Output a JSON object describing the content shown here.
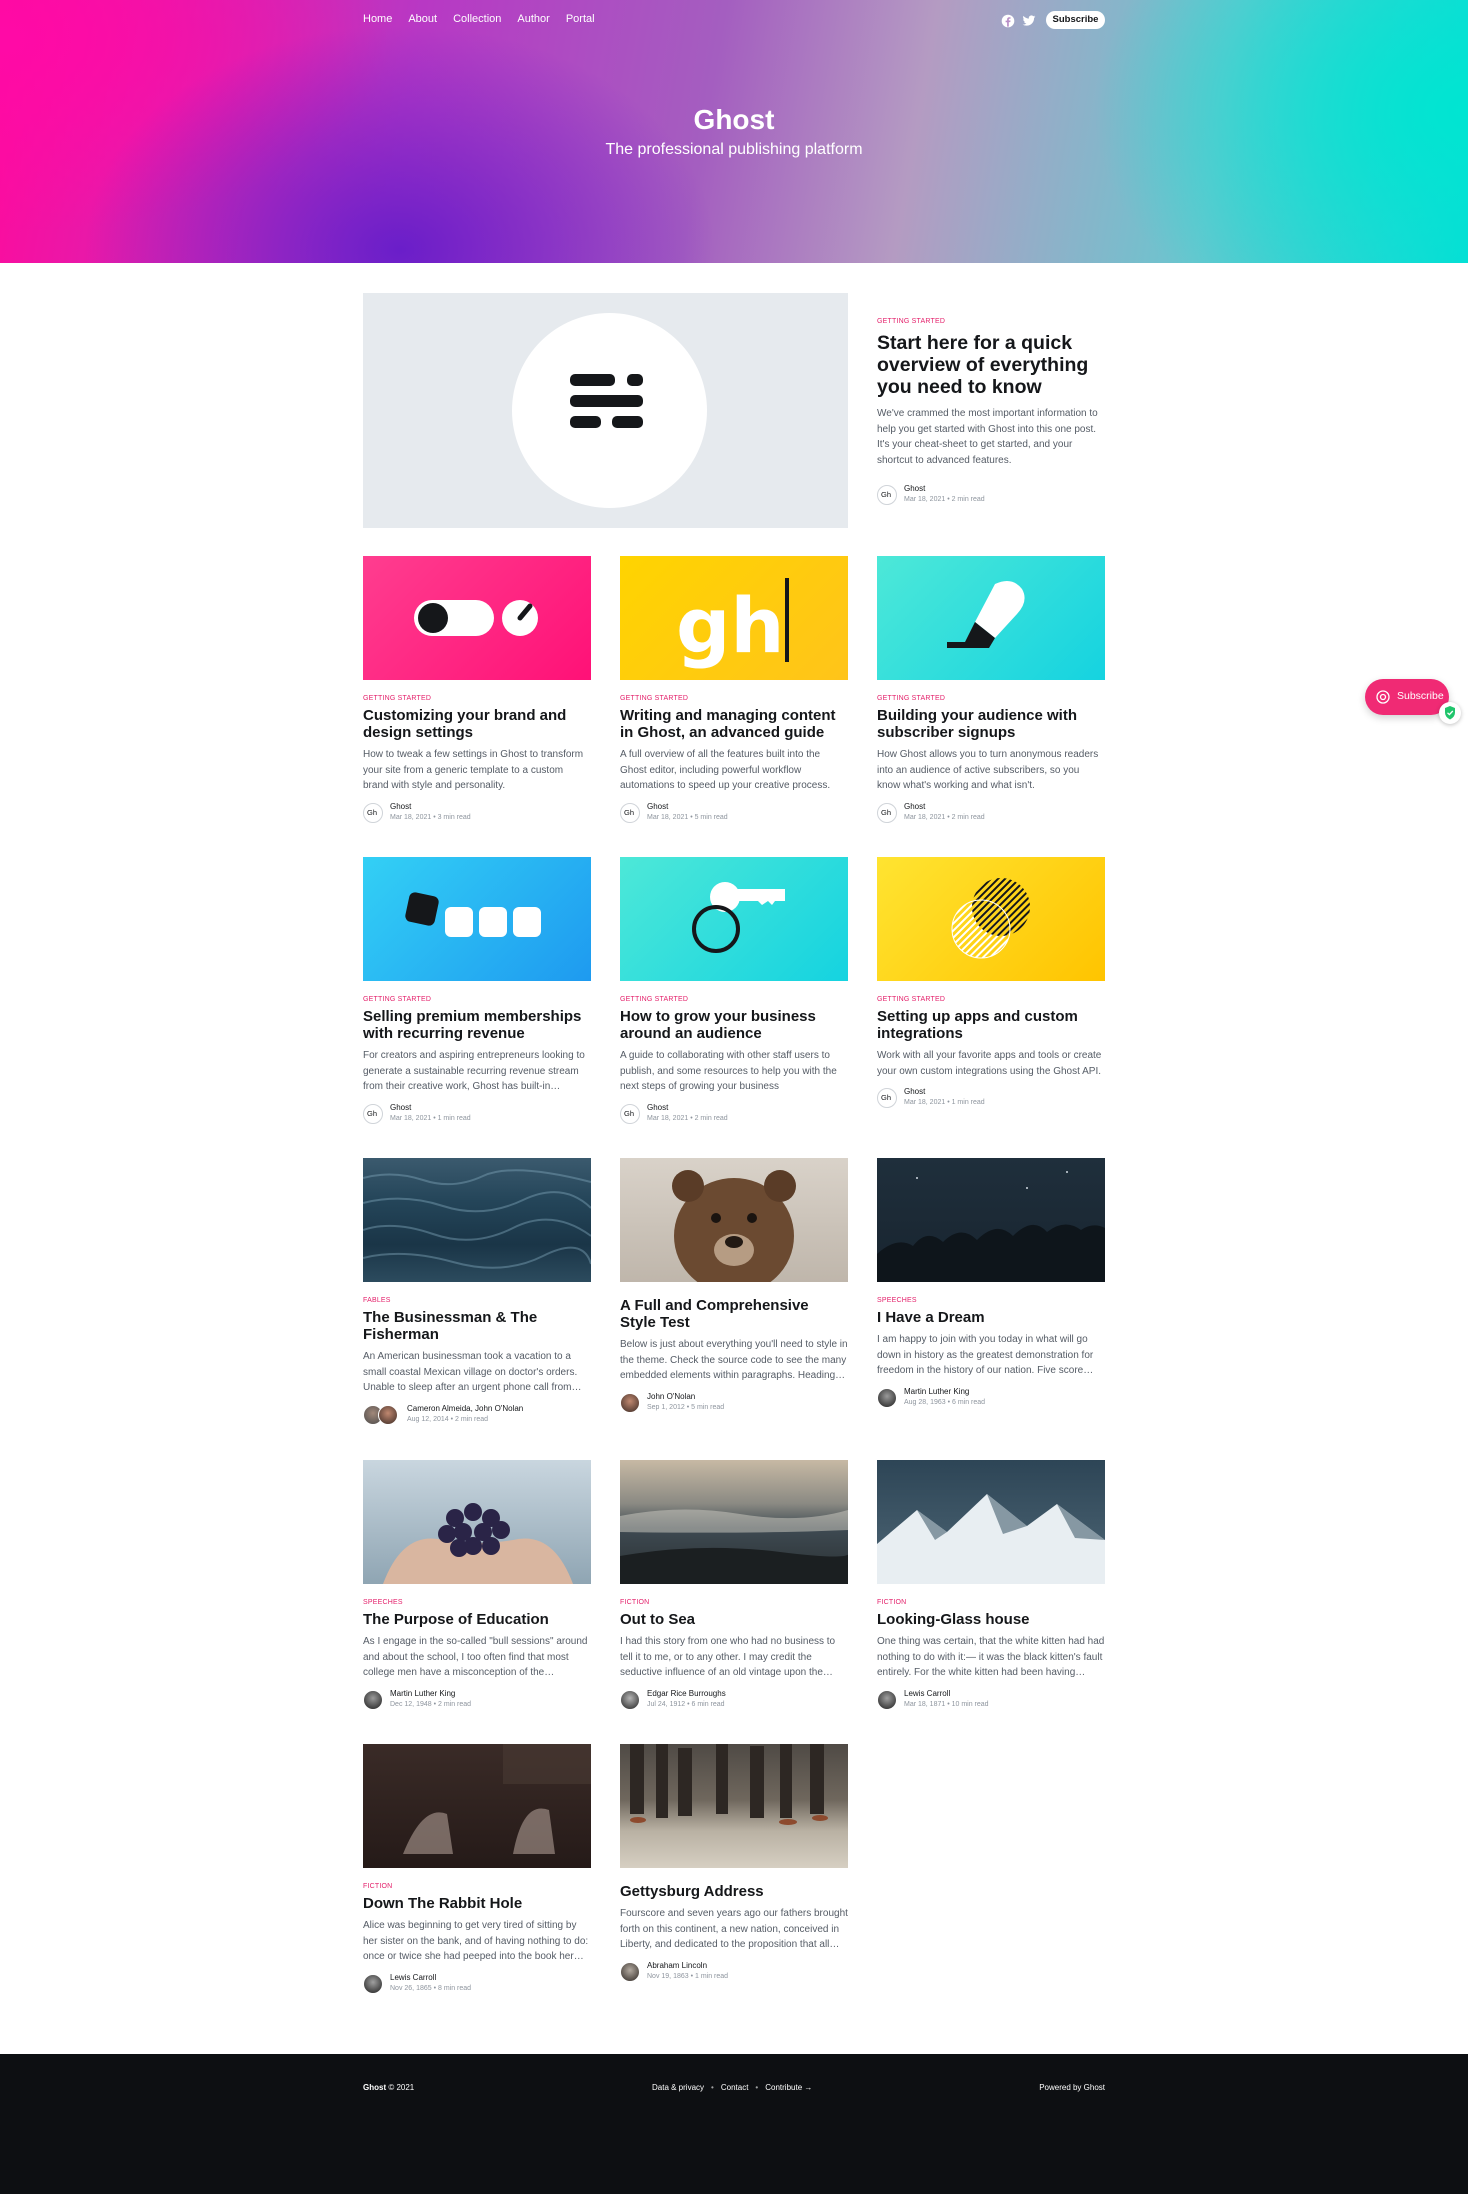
{
  "nav": {
    "items": [
      "Home",
      "About",
      "Collection",
      "Author",
      "Portal"
    ],
    "subscribe_label": "Subscribe",
    "social_icons": [
      "facebook-icon",
      "twitter-icon"
    ]
  },
  "site": {
    "title": "Ghost",
    "description": "The professional publishing platform"
  },
  "featured": {
    "tag": "Getting Started",
    "title": "Start here for a quick overview of everything you need to know",
    "excerpt": "We've crammed the most important information to help you get started with Ghost into this one post. It's your cheat-sheet to get started, and your shortcut to advanced features.",
    "author": "Ghost",
    "date": "Mar 18, 2021",
    "read": "2 min read"
  },
  "posts": [
    {
      "tag": "Getting Started",
      "title": "Customizing your brand and design settings",
      "excerpt": "How to tweak a few settings in Ghost to transform your site from a generic template to a custom brand with style and personality.",
      "author": "Ghost",
      "date": "Mar 18, 2021",
      "read": "3 min read"
    },
    {
      "tag": "Getting Started",
      "title": "Writing and managing content in Ghost, an advanced guide",
      "excerpt": "A full overview of all the features built into the Ghost editor, including powerful workflow automations to speed up your creative process.",
      "author": "Ghost",
      "date": "Mar 18, 2021",
      "read": "5 min read"
    },
    {
      "tag": "Getting Started",
      "title": "Building your audience with subscriber signups",
      "excerpt": "How Ghost allows you to turn anonymous readers into an audience of active subscribers, so you know what's working and what isn't.",
      "author": "Ghost",
      "date": "Mar 18, 2021",
      "read": "2 min read"
    },
    {
      "tag": "Getting Started",
      "title": "Selling premium memberships with recurring revenue",
      "excerpt": "For creators and aspiring entrepreneurs looking to generate a sustainable recurring revenue stream from their creative work, Ghost has built-in…",
      "author": "Ghost",
      "date": "Mar 18, 2021",
      "read": "1 min read"
    },
    {
      "tag": "Getting Started",
      "title": "How to grow your business around an audience",
      "excerpt": "A guide to collaborating with other staff users to publish, and some resources to help you with the next steps of growing your business",
      "author": "Ghost",
      "date": "Mar 18, 2021",
      "read": "2 min read"
    },
    {
      "tag": "Getting Started",
      "title": "Setting up apps and custom integrations",
      "excerpt": "Work with all your favorite apps and tools or create your own custom integrations using the Ghost API.",
      "author": "Ghost",
      "date": "Mar 18, 2021",
      "read": "1 min read"
    },
    {
      "tag": "Fables",
      "title": "The Businessman & The Fisherman",
      "excerpt": "An American businessman took a vacation to a small coastal Mexican village on doctor's orders. Unable to sleep after an urgent phone call from th…",
      "author": "Cameron Almeida, John O'Nolan",
      "date": "Aug 12, 2014",
      "read": "2 min read"
    },
    {
      "tag": "",
      "title": "A Full and Comprehensive Style Test",
      "excerpt": "Below is just about everything you'll need to style in the theme. Check the source code to see the many embedded elements within paragraphs. Heading 1…",
      "author": "John O'Nolan",
      "date": "Sep 1, 2012",
      "read": "5 min read"
    },
    {
      "tag": "Speeches",
      "title": "I Have a Dream",
      "excerpt": "I am happy to join with you today in what will go down in history as the greatest demonstration for freedom in the history of our nation. Five score…",
      "author": "Martin Luther King",
      "date": "Aug 28, 1963",
      "read": "6 min read"
    },
    {
      "tag": "Speeches",
      "title": "The Purpose of Education",
      "excerpt": "As I engage in the so-called \"bull sessions\" around and about the school, I too often find that most college men have a misconception of the purpose…",
      "author": "Martin Luther King",
      "date": "Dec 12, 1948",
      "read": "2 min read"
    },
    {
      "tag": "Fiction",
      "title": "Out to Sea",
      "excerpt": "I had this story from one who had no business to tell it to me, or to any other. I may credit the seductive influence of an old vintage upon the…",
      "author": "Edgar Rice Burroughs",
      "date": "Jul 24, 1912",
      "read": "6 min read"
    },
    {
      "tag": "Fiction",
      "title": "Looking-Glass house",
      "excerpt": "One thing was certain, that the white kitten had had nothing to do with it:— it was the black kitten's fault entirely. For the white kitten had been having…",
      "author": "Lewis Carroll",
      "date": "Mar 18, 1871",
      "read": "10 min read"
    },
    {
      "tag": "Fiction",
      "title": "Down The Rabbit Hole",
      "excerpt": "Alice was beginning to get very tired of sitting by her sister on the bank, and of having nothing to do: once or twice she had peeped into the book her…",
      "author": "Lewis Carroll",
      "date": "Nov 26, 1865",
      "read": "8 min read"
    },
    {
      "tag": "",
      "title": "Gettysburg Address",
      "excerpt": "Fourscore and seven years ago our fathers brought forth on this continent, a new nation, conceived in Liberty, and dedicated to the proposition that all…",
      "author": "Abraham Lincoln",
      "date": "Nov 19, 1863",
      "read": "1 min read"
    }
  ],
  "avatar_text": "Gh",
  "portal": {
    "label": "Subscribe"
  },
  "footer": {
    "brand": "Ghost",
    "copyright": "© 2021",
    "links": [
      "Data & privacy",
      "Contact",
      "Contribute →"
    ],
    "powered": "Powered by Ghost"
  },
  "colors": {
    "accent": "#e4216b",
    "portal": "#f02a74",
    "footer": "#0d0f12"
  }
}
